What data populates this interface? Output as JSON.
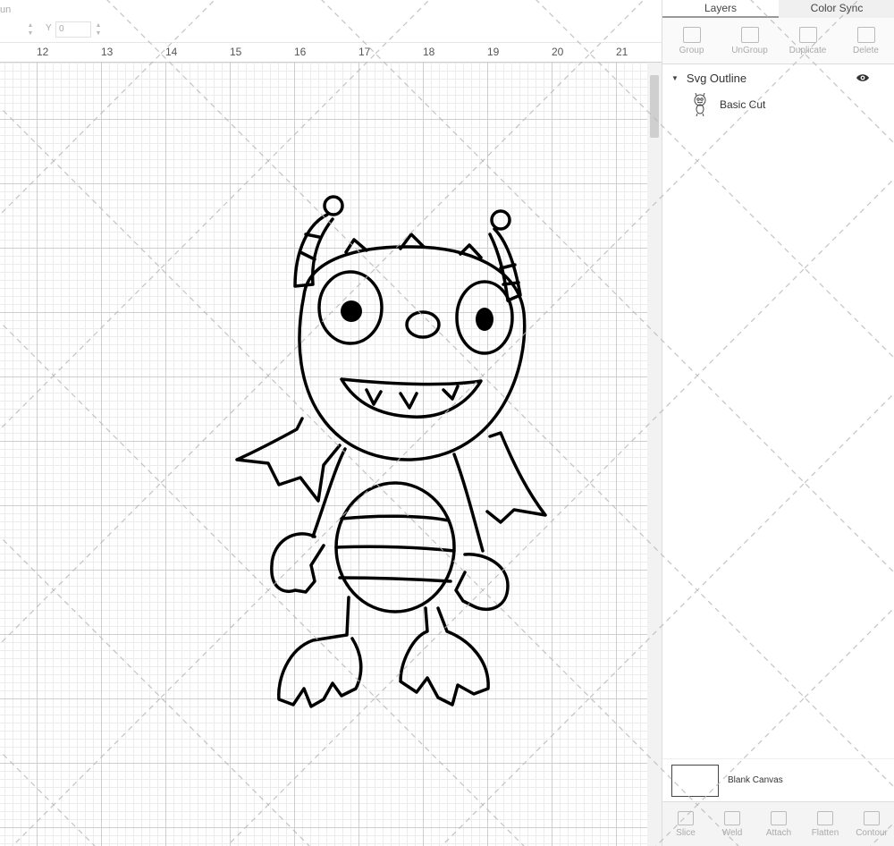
{
  "toolbar": {
    "cut_label": "un",
    "y_label": "Y",
    "y_value": "0"
  },
  "ruler": {
    "ticks": [
      "12",
      "13",
      "14",
      "15",
      "16",
      "17",
      "18",
      "19",
      "20",
      "21"
    ]
  },
  "panel": {
    "tabs": [
      {
        "label": "Layers",
        "active": true
      },
      {
        "label": "Color Sync",
        "active": false
      }
    ],
    "tools": [
      {
        "label": "Group",
        "icon": "group-icon"
      },
      {
        "label": "UnGroup",
        "icon": "ungroup-icon"
      },
      {
        "label": "Duplicate",
        "icon": "duplicate-icon"
      },
      {
        "label": "Delete",
        "icon": "trash-icon"
      }
    ],
    "layers": {
      "group_name": "Svg Outline",
      "items": [
        {
          "label": "Basic Cut",
          "icon": "monster-thumbnail-icon"
        }
      ]
    },
    "blank_canvas_label": "Blank Canvas",
    "bottom_tools": [
      {
        "label": "Slice",
        "icon": "slice-icon"
      },
      {
        "label": "Weld",
        "icon": "weld-icon"
      },
      {
        "label": "Attach",
        "icon": "attach-icon"
      },
      {
        "label": "Flatten",
        "icon": "flatten-icon"
      },
      {
        "label": "Contour",
        "icon": "contour-icon"
      }
    ]
  },
  "colors": {
    "outline": "#000000",
    "grid_major": "#cfcfcf",
    "grid_minor": "#ececec",
    "panel_bg": "#ffffff"
  }
}
